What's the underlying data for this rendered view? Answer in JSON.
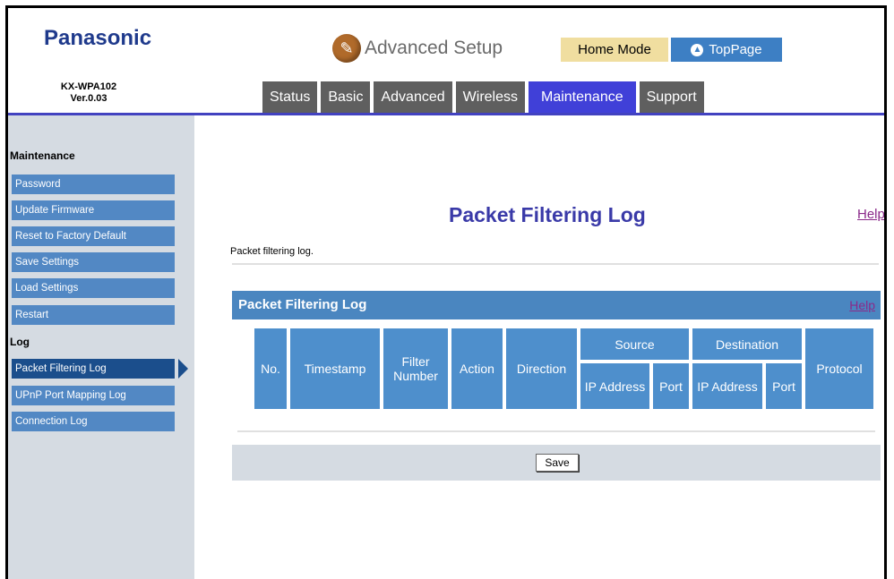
{
  "header": {
    "brand": "Panasonic",
    "model": "KX-WPA102",
    "version": "Ver.0.03",
    "title": "Advanced Setup",
    "title_icon": "wrench-icon",
    "home_mode": "Home Mode",
    "top_page": "TopPage"
  },
  "tabs": [
    {
      "label": "Status"
    },
    {
      "label": "Basic"
    },
    {
      "label": "Advanced"
    },
    {
      "label": "Wireless"
    },
    {
      "label": "Maintenance",
      "active": true
    },
    {
      "label": "Support"
    }
  ],
  "sidebar": {
    "sections": [
      {
        "heading": "Maintenance",
        "items": [
          {
            "label": "Password"
          },
          {
            "label": "Update Firmware"
          },
          {
            "label": "Reset to Factory Default"
          },
          {
            "label": "Save Settings"
          },
          {
            "label": "Load Settings"
          },
          {
            "label": "Restart"
          }
        ]
      },
      {
        "heading": "Log",
        "items": [
          {
            "label": "Packet Filtering Log",
            "active": true
          },
          {
            "label": "UPnP Port Mapping Log"
          },
          {
            "label": "Connection Log"
          }
        ]
      }
    ]
  },
  "main": {
    "page_title": "Packet Filtering Log",
    "help": "Help",
    "description": "Packet filtering log.",
    "section_title": "Packet Filtering Log",
    "section_help": "Help",
    "table_headers": {
      "no": "No.",
      "timestamp": "Timestamp",
      "filter_number": "Filter Number",
      "action": "Action",
      "direction": "Direction",
      "source": "Source",
      "destination": "Destination",
      "ip_address": "IP Address",
      "port": "Port",
      "protocol": "Protocol"
    },
    "save_label": "Save"
  },
  "colors": {
    "brand": "#1f3a8c",
    "tab_active": "#4040d8",
    "tab_inactive": "#5f5f5f",
    "sidebar_item": "#5288c4",
    "sidebar_active": "#1b4e8c",
    "table_header": "#4e8fcc",
    "title": "#3a3aa8",
    "link": "#8a2a8a"
  }
}
